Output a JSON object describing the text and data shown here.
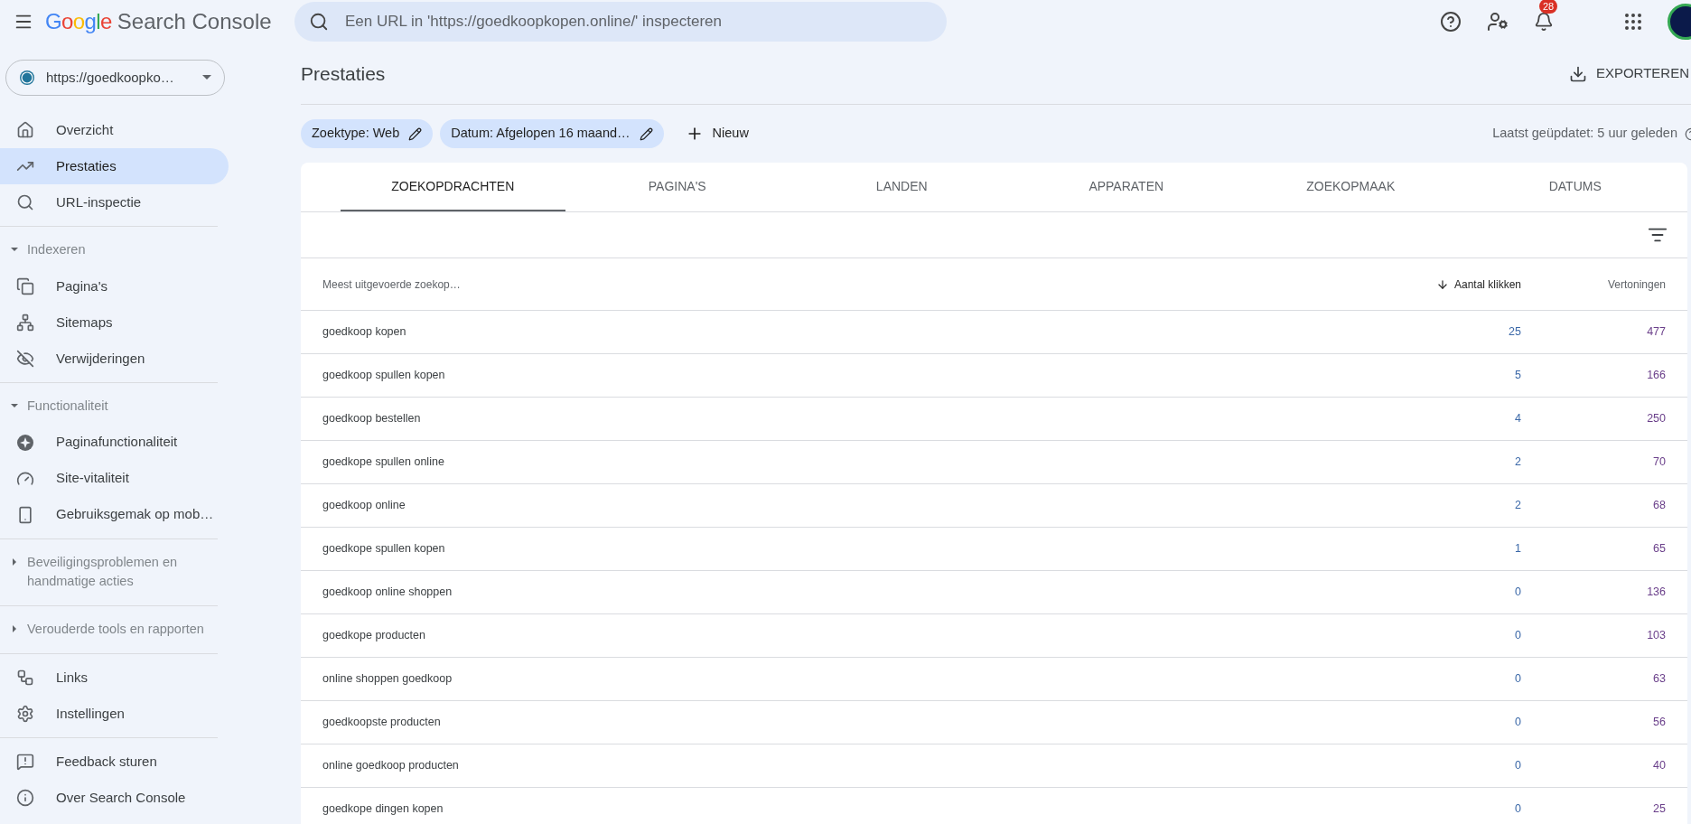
{
  "header": {
    "brand": "Google",
    "product": "Search Console",
    "search": {
      "placeholder": "Een URL in 'https://goedkoopkopen.online/' inspecteren"
    },
    "notifications": "28"
  },
  "sidebar": {
    "property": "https://goedkoopko…",
    "sections": [
      {
        "kind": "plain",
        "items": [
          {
            "label": "Overzicht",
            "selected": false
          },
          {
            "label": "Prestaties",
            "selected": true
          },
          {
            "label": "URL-inspectie",
            "selected": false
          }
        ]
      },
      {
        "kind": "group",
        "label": "Indexeren",
        "expanded": true,
        "items": [
          {
            "label": "Pagina's",
            "selected": false
          },
          {
            "label": "Sitemaps",
            "selected": false
          },
          {
            "label": "Verwijderingen",
            "selected": false
          }
        ]
      },
      {
        "kind": "group",
        "label": "Functionaliteit",
        "expanded": true,
        "items": [
          {
            "label": "Paginafunctionaliteit",
            "selected": false
          },
          {
            "label": "Site-vitaliteit",
            "selected": false
          },
          {
            "label": "Gebruiksgemak op mob…",
            "selected": false
          }
        ]
      },
      {
        "kind": "group",
        "label": "Beveiligingsproblemen en handmatige acties",
        "expanded": false
      },
      {
        "kind": "group",
        "label": "Verouderde tools en rapporten",
        "expanded": false
      },
      {
        "kind": "plain",
        "items": [
          {
            "label": "Links",
            "selected": false
          },
          {
            "label": "Instellingen",
            "selected": false
          }
        ]
      },
      {
        "kind": "plain",
        "items": [
          {
            "label": "Feedback sturen",
            "selected": false
          },
          {
            "label": "Over Search Console",
            "selected": false
          }
        ]
      }
    ]
  },
  "page": {
    "title": "Prestaties",
    "export": "EXPORTEREN",
    "filters": [
      "Zoektype: Web",
      "Datum: Afgelopen 16 maand…"
    ],
    "new_filter": "Nieuw",
    "updated": "Laatst geüpdatet: 5 uur geleden"
  },
  "tabs": [
    {
      "label": "ZOEKOPDRACHTEN",
      "selected": true
    },
    {
      "label": "PAGINA'S",
      "selected": false
    },
    {
      "label": "LANDEN",
      "selected": false
    },
    {
      "label": "APPARATEN",
      "selected": false
    },
    {
      "label": "ZOEKOPMAAK",
      "selected": false
    },
    {
      "label": "DATUMS",
      "selected": false
    }
  ],
  "table": {
    "columns": [
      {
        "label": "Meest uitgevoerde zoekop…",
        "sorted": false
      },
      {
        "label": "Aantal klikken",
        "sorted": true
      },
      {
        "label": "Vertoningen",
        "sorted": false
      }
    ],
    "rows": [
      {
        "query": "goedkoop kopen",
        "clicks": "25",
        "impressions": "477"
      },
      {
        "query": "goedkoop spullen kopen",
        "clicks": "5",
        "impressions": "166"
      },
      {
        "query": "goedkoop bestellen",
        "clicks": "4",
        "impressions": "250"
      },
      {
        "query": "goedkope spullen online",
        "clicks": "2",
        "impressions": "70"
      },
      {
        "query": "goedkoop online",
        "clicks": "2",
        "impressions": "68"
      },
      {
        "query": "goedkope spullen kopen",
        "clicks": "1",
        "impressions": "65"
      },
      {
        "query": "goedkoop online shoppen",
        "clicks": "0",
        "impressions": "136"
      },
      {
        "query": "goedkope producten",
        "clicks": "0",
        "impressions": "103"
      },
      {
        "query": "online shoppen goedkoop",
        "clicks": "0",
        "impressions": "63"
      },
      {
        "query": "goedkoopste producten",
        "clicks": "0",
        "impressions": "56"
      },
      {
        "query": "online goedkoop producten",
        "clicks": "0",
        "impressions": "40"
      },
      {
        "query": "goedkope dingen kopen",
        "clicks": "0",
        "impressions": "25"
      }
    ]
  }
}
